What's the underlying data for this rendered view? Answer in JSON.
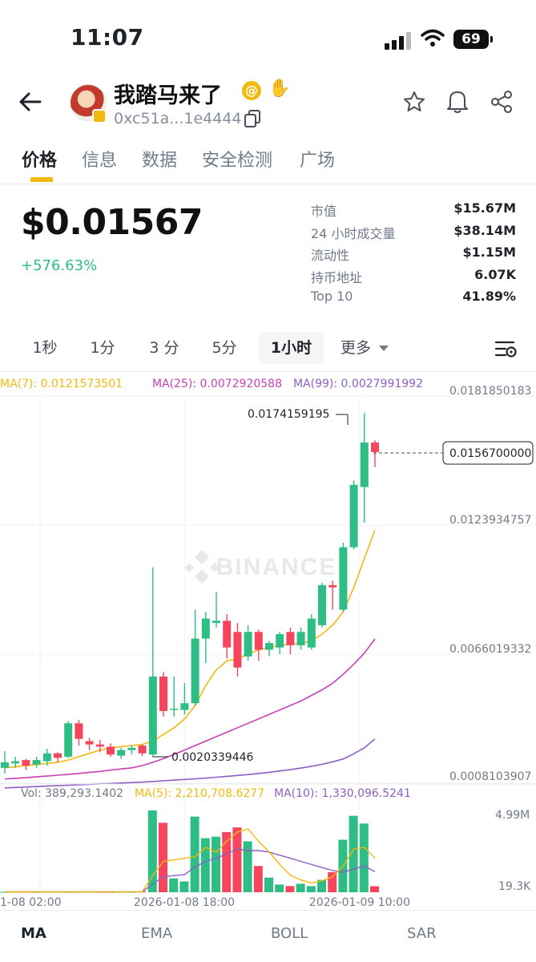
{
  "status_bar": {
    "time": "11:07",
    "battery": "69"
  },
  "header": {
    "token_name": "我踏马来了",
    "at_icon": "@",
    "contract": "0xc51a...1e4444",
    "icons": [
      "back-arrow-icon",
      "copy-icon",
      "star-icon",
      "bell-icon",
      "share-icon",
      "waving-hand-icon"
    ]
  },
  "tabs": [
    {
      "label": "价格",
      "active": true
    },
    {
      "label": "信息"
    },
    {
      "label": "数据"
    },
    {
      "label": "安全检测"
    },
    {
      "label": "广场"
    }
  ],
  "price": {
    "value": "$0.01567",
    "change": "+576.63%",
    "stats": [
      {
        "label": "市值",
        "value": "$15.67M"
      },
      {
        "label": "24 小时成交量",
        "value": "$38.14M"
      },
      {
        "label": "流动性",
        "value": "$1.15M"
      },
      {
        "label": "持币地址",
        "value": "6.07K"
      },
      {
        "label": "Top 10",
        "value": "41.89%"
      }
    ]
  },
  "intervals": [
    {
      "label": "1秒"
    },
    {
      "label": "1分"
    },
    {
      "label": "3 分"
    },
    {
      "label": "5分"
    },
    {
      "label": "1小时",
      "active": true
    },
    {
      "label": "更多"
    }
  ],
  "colors": {
    "up": "#2ebd85",
    "down": "#f6465d",
    "ma7": "#f0b90b",
    "ma25": "#c740b6",
    "ma99": "#8c5fc4",
    "accent": "#f0b90b"
  },
  "chart_data": {
    "type": "candlestick",
    "legend": {
      "ma7": "MA(7): 0.0121573501",
      "ma25": "MA(25): 0.0072920588",
      "ma99": "MA(99): 0.0027991992"
    },
    "y_axis_labels": [
      "0.0181850183",
      "0.0123934757",
      "0.0066019332",
      "0.0008103907"
    ],
    "y_axis_values": [
      0.0181850183,
      0.0123934757,
      0.0066019332,
      0.0008103907
    ],
    "high_label": "0.0174159195",
    "low_label": "0.0020339446",
    "current_price_label": "0.0156700000",
    "current_price": 0.01567,
    "watermark": "BINANCE",
    "candles": [
      [
        0.0015,
        0.00175,
        0.00125,
        0.00225
      ],
      [
        0.0017,
        0.0018,
        0.0015,
        0.002
      ],
      [
        0.00185,
        0.0016,
        0.0014,
        0.0019
      ],
      [
        0.00165,
        0.00185,
        0.0015,
        0.002
      ],
      [
        0.0018,
        0.00215,
        0.0016,
        0.00235
      ],
      [
        0.00215,
        0.00195,
        0.00175,
        0.0022
      ],
      [
        0.002,
        0.0035,
        0.00195,
        0.0036
      ],
      [
        0.0035,
        0.0028,
        0.0025,
        0.00365
      ],
      [
        0.0027,
        0.00255,
        0.0023,
        0.00285
      ],
      [
        0.00255,
        0.00245,
        0.0022,
        0.00275
      ],
      [
        0.00245,
        0.0021,
        0.002,
        0.0026
      ],
      [
        0.00205,
        0.0023,
        0.0019,
        0.0024
      ],
      [
        0.0023,
        0.0024,
        0.0021,
        0.0025
      ],
      [
        0.0025,
        0.00215,
        0.00203,
        0.00255
      ],
      [
        0.0021,
        0.0056,
        0.00203,
        0.0105
      ],
      [
        0.0056,
        0.00405,
        0.0038,
        0.0058
      ],
      [
        0.0041,
        0.00415,
        0.0038,
        0.0056
      ],
      [
        0.0041,
        0.0044,
        0.0039,
        0.0053
      ],
      [
        0.0044,
        0.0073,
        0.0043,
        0.0086
      ],
      [
        0.0073,
        0.0082,
        0.0062,
        0.0085
      ],
      [
        0.008,
        0.0081,
        0.0078,
        0.0094
      ],
      [
        0.0081,
        0.0069,
        0.0064,
        0.0084
      ],
      [
        0.0076,
        0.006,
        0.0056,
        0.008
      ],
      [
        0.0065,
        0.0076,
        0.0063,
        0.0079
      ],
      [
        0.0076,
        0.0068,
        0.0063,
        0.0077
      ],
      [
        0.0068,
        0.0071,
        0.0065,
        0.0072
      ],
      [
        0.0069,
        0.0075,
        0.0066,
        0.0076
      ],
      [
        0.0076,
        0.007,
        0.0066,
        0.0078
      ],
      [
        0.007,
        0.0076,
        0.0068,
        0.0078
      ],
      [
        0.0069,
        0.0082,
        0.0068,
        0.0084
      ],
      [
        0.0079,
        0.0097,
        0.0078,
        0.0098
      ],
      [
        0.0097,
        0.0096,
        0.0086,
        0.0099
      ],
      [
        0.0086,
        0.0114,
        0.0085,
        0.0116
      ],
      [
        0.0114,
        0.0142,
        0.0113,
        0.0144
      ],
      [
        0.0141,
        0.0161,
        0.0125,
        0.01742
      ],
      [
        0.0161,
        0.01567,
        0.015,
        0.0162
      ]
    ],
    "ma7": [
      0.0015,
      0.00155,
      0.0016,
      0.00165,
      0.0017,
      0.00175,
      0.00185,
      0.002,
      0.00215,
      0.0023,
      0.0024,
      0.00245,
      0.0025,
      0.00255,
      0.0027,
      0.003,
      0.0033,
      0.0037,
      0.0043,
      0.0052,
      0.0059,
      0.0063,
      0.0064,
      0.0066,
      0.0068,
      0.0069,
      0.007,
      0.00705,
      0.0071,
      0.0072,
      0.0075,
      0.0079,
      0.0085,
      0.0096,
      0.0109,
      0.01216
    ],
    "ma25": [
      0.001,
      0.00103,
      0.00106,
      0.0011,
      0.00113,
      0.00117,
      0.00121,
      0.00125,
      0.0013,
      0.00134,
      0.0014,
      0.00145,
      0.0015,
      0.0016,
      0.00175,
      0.00192,
      0.0021,
      0.0023,
      0.0025,
      0.0027,
      0.0029,
      0.0031,
      0.0033,
      0.0035,
      0.0037,
      0.0039,
      0.0041,
      0.0043,
      0.0045,
      0.00475,
      0.005,
      0.0053,
      0.0057,
      0.00615,
      0.00665,
      0.00729
    ],
    "ma99": [
      0.0006,
      0.00062,
      0.00064,
      0.00066,
      0.00068,
      0.0007,
      0.00072,
      0.00074,
      0.00076,
      0.00078,
      0.0008,
      0.00082,
      0.00084,
      0.00086,
      0.00089,
      0.00092,
      0.00095,
      0.00098,
      0.00101,
      0.00104,
      0.00108,
      0.00112,
      0.00116,
      0.0012,
      0.00125,
      0.0013,
      0.00136,
      0.00142,
      0.00149,
      0.00157,
      0.00166,
      0.00177,
      0.0019,
      0.00213,
      0.0024,
      0.0028
    ],
    "volume": {
      "legend_vol": "Vol: 389,293.1402",
      "legend_ma5": "MA(5): 2,210,708.6277",
      "legend_ma10": "MA(10): 1,330,096.5241",
      "y_axis_labels": [
        "4.99M",
        "19.3K"
      ],
      "max": 5400000,
      "values": [
        20000,
        30000,
        25000,
        20000,
        35000,
        30000,
        20000,
        25000,
        40000,
        30000,
        20000,
        30000,
        25000,
        60000,
        5300000,
        4500000,
        900000,
        700000,
        4900000,
        3500000,
        3600000,
        3900000,
        4200000,
        3300000,
        1700000,
        950000,
        500000,
        400000,
        550000,
        400000,
        800000,
        1300000,
        3400000,
        4950000,
        4450000,
        390000
      ],
      "ma5": [
        30000,
        28000,
        27000,
        26000,
        25000,
        27000,
        28000,
        27000,
        28000,
        30000,
        28000,
        28000,
        30000,
        35000,
        1100000,
        2000000,
        2100000,
        2200000,
        2300000,
        2900000,
        2600000,
        3300000,
        3900000,
        4100000,
        3300000,
        2600000,
        1800000,
        1100000,
        800000,
        600000,
        750000,
        1000000,
        1700000,
        2800000,
        2900000,
        2210000
      ],
      "ma10": [
        30000,
        30000,
        29000,
        28000,
        28000,
        28000,
        28000,
        27000,
        27000,
        28000,
        28000,
        28000,
        28000,
        30000,
        550000,
        1000000,
        1080000,
        1150000,
        1650000,
        2000000,
        2200000,
        2500000,
        2800000,
        2700000,
        2700000,
        2600000,
        2400000,
        2200000,
        2000000,
        1800000,
        1600000,
        1400000,
        1300000,
        1500000,
        1700000,
        1330000
      ]
    },
    "x_axis_labels": [
      "1-08 02:00",
      "2026-01-08 18:00",
      "2026-01-09 10:00"
    ]
  },
  "indicators": [
    {
      "label": "MA",
      "active": true
    },
    {
      "label": "EMA"
    },
    {
      "label": "BOLL"
    },
    {
      "label": "SAR"
    }
  ]
}
